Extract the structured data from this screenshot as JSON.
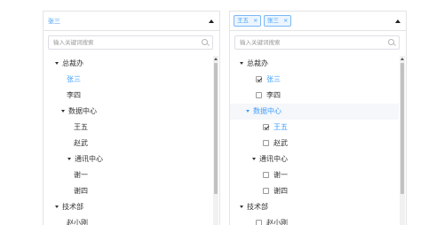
{
  "left_panel": {
    "selected_value": "张三",
    "search": {
      "placeholder": "输入关键词搜索"
    },
    "tree": {
      "root": "总裁办",
      "items": [
        "张三",
        "李四"
      ],
      "group1": {
        "label": "数据中心",
        "items": [
          "王五",
          "赵武"
        ]
      },
      "group2": {
        "label": "通讯中心",
        "items": [
          "谢一",
          "谢四"
        ]
      },
      "root2": "技术部",
      "root2_items": [
        "赵小刚"
      ]
    }
  },
  "right_panel": {
    "tags": [
      {
        "label": "王五",
        "close": "×"
      },
      {
        "label": "张三",
        "close": "×"
      }
    ],
    "search": {
      "placeholder": "输入关键词搜索"
    },
    "tree": {
      "root": "总裁办",
      "items": [
        {
          "label": "张三",
          "checked": true
        },
        {
          "label": "李四",
          "checked": false
        }
      ],
      "group1": {
        "label": "数据中心",
        "items": [
          {
            "label": "王五",
            "checked": true
          },
          {
            "label": "赵武",
            "checked": false
          }
        ]
      },
      "group2": {
        "label": "通讯中心",
        "items": [
          {
            "label": "谢一",
            "checked": false
          },
          {
            "label": "谢四",
            "checked": false
          }
        ]
      },
      "root2": "技术部",
      "root2_items": [
        {
          "label": "赵小刚",
          "checked": false
        }
      ]
    }
  },
  "colors": {
    "accent": "#409eff",
    "border": "#e4e4e4",
    "highlight_row": "#f5f7fa"
  }
}
